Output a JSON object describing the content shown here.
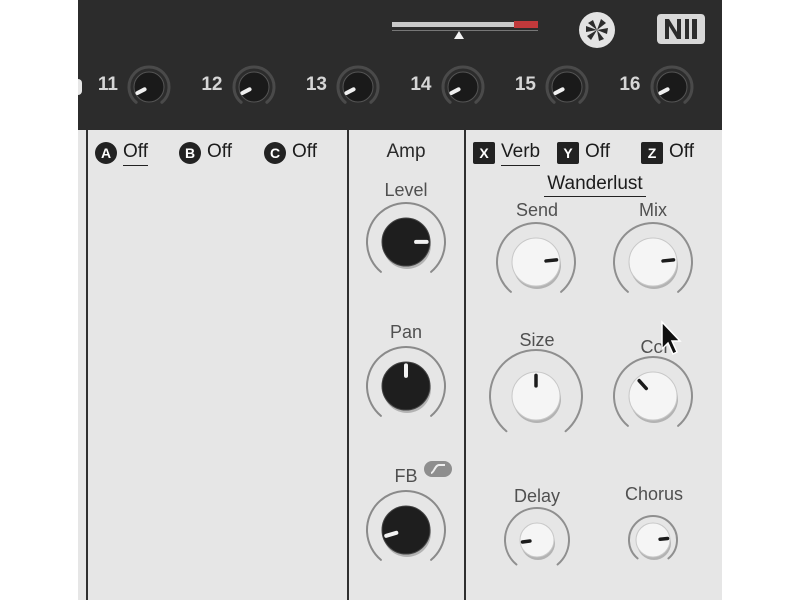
{
  "header": {
    "meter_level": 0.84,
    "macros": [
      {
        "label": "11",
        "value": 0.08
      },
      {
        "label": "12",
        "value": 0.08
      },
      {
        "label": "13",
        "value": 0.08
      },
      {
        "label": "14",
        "value": 0.08
      },
      {
        "label": "15",
        "value": 0.08
      },
      {
        "label": "16",
        "value": 0.08
      }
    ]
  },
  "insert_slots": [
    {
      "badge": "A",
      "value": "Off"
    },
    {
      "badge": "B",
      "value": "Off"
    },
    {
      "badge": "C",
      "value": "Off"
    }
  ],
  "amp": {
    "title": "Amp",
    "knobs": [
      {
        "label": "Level",
        "value": 0.82
      },
      {
        "label": "Pan",
        "value": 0.5
      },
      {
        "label": "FB",
        "value": 0.12
      }
    ]
  },
  "send_slots": [
    {
      "badge": "X",
      "value": "Verb"
    },
    {
      "badge": "Y",
      "value": "Off"
    },
    {
      "badge": "Z",
      "value": "Off"
    }
  ],
  "wanderlust": {
    "title": "Wanderlust",
    "knobs": [
      {
        "label": "Send",
        "value": 0.8
      },
      {
        "label": "Mix",
        "value": 0.8
      },
      {
        "label": "Size",
        "value": 0.5
      },
      {
        "label": "Col",
        "value": 0.35
      },
      {
        "label": "Delay",
        "value": 0.15
      },
      {
        "label": "Chorus",
        "value": 0.8
      }
    ]
  }
}
